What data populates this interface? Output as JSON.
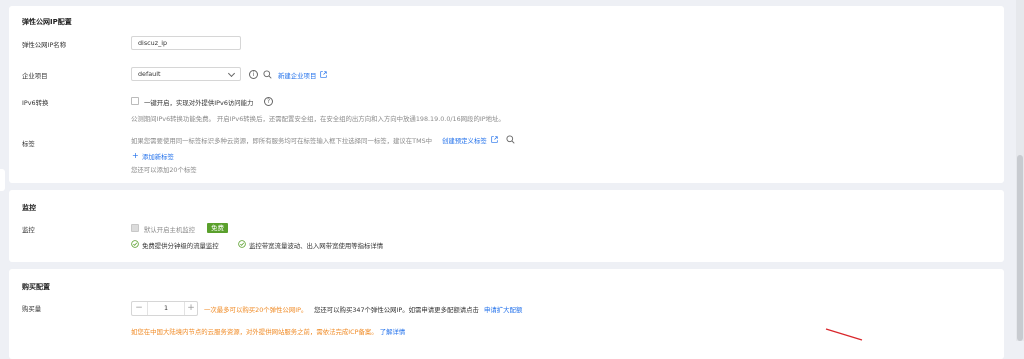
{
  "eip": {
    "section_title": "弹性公网IP配置",
    "name_label": "弹性公网IP名称",
    "name_value": "discuz_ip",
    "project_label": "企业项目",
    "project_value": "default",
    "project_new_link": "新建企业项目",
    "ipv6_label": "IPv6转换",
    "ipv6_option": "一键开启，实现对外提供IPv6访问能力",
    "ipv6_desc": "公测期间IPv6转换功能免费。 开启IPv6转换后，还需配置安全组，在安全组的出方向和入方向中放通198.19.0.0/16网段的IP地址。",
    "tag_label": "标签",
    "tag_desc": "如果您需要使用同一标签标识多种云资源，即所有服务均可在标签输入框下拉选择同一标签，建议在TMS中",
    "tag_link": "创建预定义标签",
    "tag_add": "添加新标签",
    "tag_remaining": "您还可以添加20个标签"
  },
  "monitor": {
    "section_title": "监控",
    "label": "监控",
    "option": "默认开启主机监控",
    "badge": "免费",
    "feature_1": "免费提供分钟级的流量监控",
    "feature_2": "监控带宽流量波动、出入网带宽使用等指标详情"
  },
  "purchase": {
    "section_title": "购买配置",
    "qty_label": "购买量",
    "qty_minus": "−",
    "qty_value": "1",
    "qty_plus": "+",
    "qty_limit": "一次最多可以购买20个弹性公网IP。",
    "qty_quota": "您还可以购买347个弹性公网IP。如需申请更多配额请点击",
    "qty_quota_link": "申请扩大配额",
    "icp_notice": "如您在中国大陆境内节点的云服务资源，对外提供网站服务之前，需依法完成ICP备案。",
    "icp_link": "了解详情"
  },
  "colors": {
    "accent": "#1f6feb",
    "warning": "#f08a24",
    "success": "#5aa02c",
    "background": "#eef0f5"
  }
}
